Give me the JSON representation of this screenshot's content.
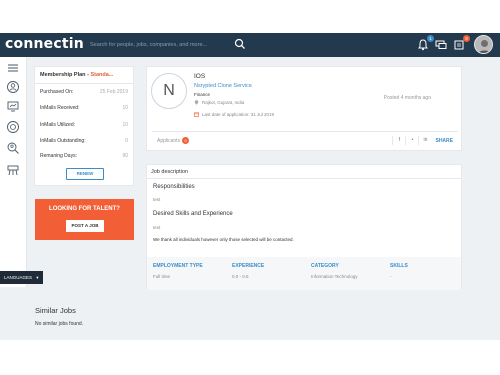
{
  "app": {
    "logo": "connectin",
    "search_placeholder": "Search for people, jobs, companies, and more...",
    "badges": {
      "notifications": "1",
      "messages": "0",
      "requests": "9"
    },
    "colors": {
      "navbar": "#233a4e",
      "accent": "#3a8dc9",
      "orange": "#f25e35"
    }
  },
  "sidebar_icons": [
    "menu-icon",
    "profile-icon",
    "network-icon",
    "groups-icon",
    "search-people-icon",
    "jobs-icon"
  ],
  "language": {
    "label": "LANGUAGES"
  },
  "membership": {
    "title_prefix": "Membership Plan - ",
    "plan": "Standa...",
    "rows": [
      {
        "label": "Purchased On:",
        "value": "25 Feb 2019"
      },
      {
        "label": "InMails Received:",
        "value": "10"
      },
      {
        "label": "InMails Utilized:",
        "value": "10"
      },
      {
        "label": "InMails Outstanding:",
        "value": "0"
      },
      {
        "label": "Remaning Days:",
        "value": "90"
      }
    ],
    "renew": "RENEW"
  },
  "talent": {
    "title": "LOOKING FOR TALENT?",
    "button": "POST A JOB"
  },
  "job": {
    "initial": "N",
    "title": "IOS",
    "company": "Nsrypted Clone Service",
    "industry": "Finance",
    "location": "Rajkot, Gujarat, India",
    "last_date": "Last date of application: 31 Jul 2019",
    "posted": "Posted 4 months ago",
    "applicants_label": "Applicants",
    "applicants_count": "0",
    "share": "SHARE"
  },
  "description": {
    "heading": "Job description",
    "responsibilities_title": "Responsibilities",
    "responsibilities_text": "test",
    "skills_title": "Desired Skills and Experience",
    "skills_text": "test",
    "note": "We thank all individuals however only those selected will be contacted.",
    "meta": [
      {
        "header": "EMPLOYMENT TYPE",
        "value": "Full time"
      },
      {
        "header": "EXPERIENCE",
        "value": "0.0 - 0.5"
      },
      {
        "header": "CATEGORY",
        "value": "Information Technology"
      },
      {
        "header": "SKILLS",
        "value": "-"
      }
    ]
  },
  "similar": {
    "title": "Similar Jobs",
    "empty": "No similar jobs found."
  }
}
